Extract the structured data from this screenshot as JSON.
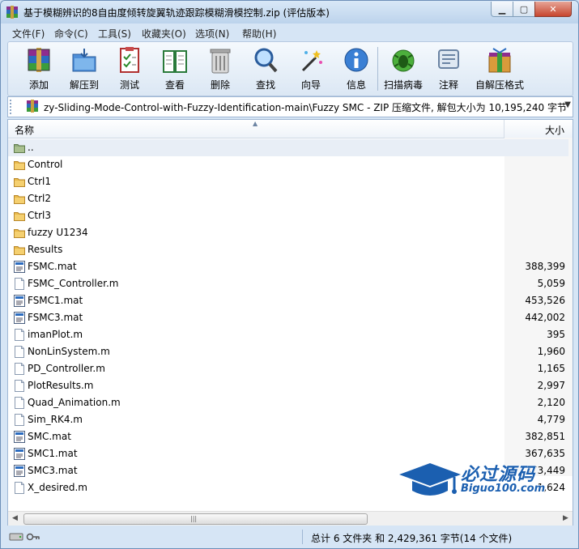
{
  "window": {
    "title": "基于模糊辨识的8自由度倾转旋翼轨迹跟踪模糊滑模控制.zip (评估版本)"
  },
  "menu": [
    "文件(F)",
    "命令(C)",
    "工具(S)",
    "收藏夹(O)",
    "选项(N)",
    "帮助(H)"
  ],
  "toolbar": [
    {
      "label": "添加",
      "icon": "archive-add-icon"
    },
    {
      "label": "解压到",
      "icon": "extract-folder-icon"
    },
    {
      "label": "测试",
      "icon": "test-checklist-icon"
    },
    {
      "label": "查看",
      "icon": "view-book-icon"
    },
    {
      "label": "删除",
      "icon": "trash-can-icon"
    },
    {
      "label": "查找",
      "icon": "magnifier-icon"
    },
    {
      "label": "向导",
      "icon": "wizard-wand-icon"
    },
    {
      "label": "信息",
      "icon": "info-icon"
    },
    {
      "label": "扫描病毒",
      "icon": "virus-scan-icon"
    },
    {
      "label": "注释",
      "icon": "comment-icon"
    },
    {
      "label": "自解压格式",
      "icon": "sfx-box-icon"
    }
  ],
  "address": {
    "path": "zy-Sliding-Mode-Control-with-Fuzzy-Identification-main\\Fuzzy SMC - ZIP 压缩文件, 解包大小为 10,195,240 字节"
  },
  "columns": {
    "name": "名称",
    "size": "大小"
  },
  "files": [
    {
      "name": "..",
      "size": "",
      "type": "up"
    },
    {
      "name": "Control",
      "size": "",
      "type": "folder"
    },
    {
      "name": "Ctrl1",
      "size": "",
      "type": "folder"
    },
    {
      "name": "Ctrl2",
      "size": "",
      "type": "folder"
    },
    {
      "name": "Ctrl3",
      "size": "",
      "type": "folder"
    },
    {
      "name": "fuzzy U1234",
      "size": "",
      "type": "folder"
    },
    {
      "name": "Results",
      "size": "",
      "type": "folder"
    },
    {
      "name": "FSMC.mat",
      "size": "388,399",
      "type": "mat"
    },
    {
      "name": "FSMC_Controller.m",
      "size": "5,059",
      "type": "m"
    },
    {
      "name": "FSMC1.mat",
      "size": "453,526",
      "type": "mat"
    },
    {
      "name": "FSMC3.mat",
      "size": "442,002",
      "type": "mat"
    },
    {
      "name": "imanPlot.m",
      "size": "395",
      "type": "m"
    },
    {
      "name": "NonLinSystem.m",
      "size": "1,960",
      "type": "m"
    },
    {
      "name": "PD_Controller.m",
      "size": "1,165",
      "type": "m"
    },
    {
      "name": "PlotResults.m",
      "size": "2,997",
      "type": "m"
    },
    {
      "name": "Quad_Animation.m",
      "size": "2,120",
      "type": "m"
    },
    {
      "name": "Sim_RK4.m",
      "size": "4,779",
      "type": "m"
    },
    {
      "name": "SMC.mat",
      "size": "382,851",
      "type": "mat"
    },
    {
      "name": "SMC1.mat",
      "size": "367,635",
      "type": "mat"
    },
    {
      "name": "SMC3.mat",
      "size": "373,449",
      "type": "mat"
    },
    {
      "name": "X_desired.m",
      "size": "1,624",
      "type": "m"
    }
  ],
  "status": {
    "summary": "总计 6 文件夹 和 2,429,361 字节(14 个文件)"
  },
  "watermark": {
    "main": "必过源码",
    "sub": "Biguo100.com"
  }
}
